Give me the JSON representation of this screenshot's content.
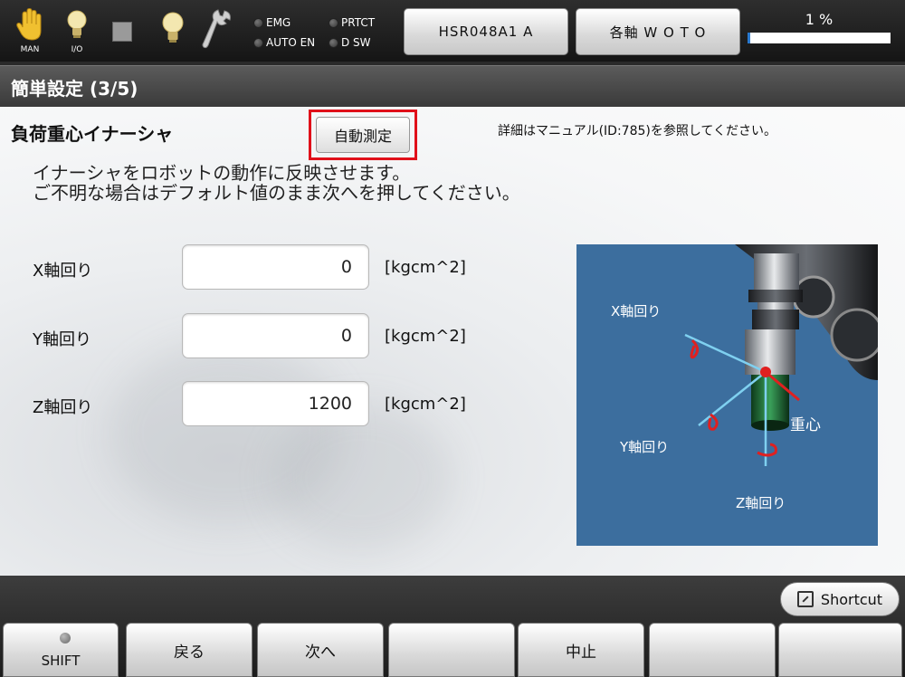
{
  "topbar": {
    "mode_caption": "MAN",
    "io_caption": "I/O",
    "leds": {
      "emg": "EMG",
      "prtct": "PRTCT",
      "auto_en": "AUTO EN",
      "dsw": "D SW"
    },
    "robot_button": "HSR048A1 A",
    "axis_button": "各軸 W O T O",
    "speed": {
      "label": "1 %",
      "value": 1
    }
  },
  "title": "簡単設定 (3/5)",
  "section": {
    "title": "負荷重心イナーシャ",
    "auto_measure_button": "自動測定",
    "manual_note": "詳細はマニュアル(ID:785)を参照してください。",
    "description_line1": "イナーシャをロボットの動作に反映させます。",
    "description_line2": "ご不明な場合はデフォルト値のまま次へを押してください。"
  },
  "fields": [
    {
      "label": "X軸回り",
      "value": "0",
      "unit": "[kgcm^2]"
    },
    {
      "label": "Y軸回り",
      "value": "0",
      "unit": "[kgcm^2]"
    },
    {
      "label": "Z軸回り",
      "value": "1200",
      "unit": "[kgcm^2]"
    }
  ],
  "diagram": {
    "x_label": "X軸回り",
    "y_label": "Y軸回り",
    "z_label": "Z軸回り",
    "center_label": "重心"
  },
  "bottombar": {
    "shortcut": "Shortcut",
    "keys": [
      "SHIFT",
      "戻る",
      "次へ",
      "",
      "中止",
      "",
      ""
    ]
  },
  "colors": {
    "highlight": "#e0101a",
    "diagram_bg": "#3c6e9e",
    "axis_line": "#7fd0f0",
    "rotation_arrow": "#e02020"
  },
  "icons": [
    "hand-icon",
    "lightbulb-icon",
    "stop-square-icon",
    "lightbulb-icon",
    "wrench-icon",
    "shortcut-icon"
  ]
}
